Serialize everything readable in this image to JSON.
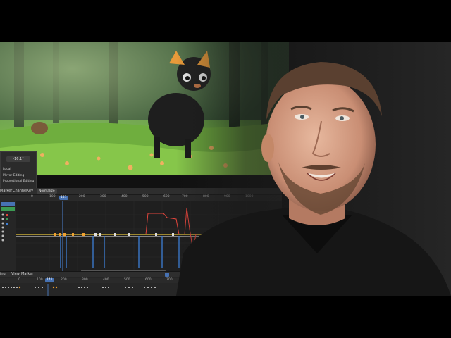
{
  "sidepanel": {
    "value": "-16.1°",
    "mode": "Local",
    "option1": "Mirror Editing",
    "option2": "Proportional Editing"
  },
  "graph_editor": {
    "menu": [
      "Marker",
      "Channel",
      "Key"
    ],
    "normalize_label": "Normalize",
    "current_frame": "141",
    "ruler_ticks": [
      "0",
      "100",
      "200",
      "300",
      "400",
      "500",
      "600",
      "700",
      "800",
      "900",
      "1000"
    ]
  },
  "dopesheet": {
    "menu": [
      "ing",
      "View",
      "Marker"
    ],
    "current_frame": "141",
    "ruler_ticks": [
      "0",
      "100",
      "200",
      "300",
      "400",
      "500",
      "600",
      "700"
    ]
  },
  "colors": {
    "accent": "#4772b3",
    "curve_red": "#e0453c",
    "curve_blue": "#3d7fd6",
    "curve_yellow": "#e8c53a",
    "key_orange": "#f0a030"
  },
  "icons": [
    "play-icon",
    "eye-icon",
    "lock-icon",
    "camera-icon",
    "speaker-icon"
  ]
}
